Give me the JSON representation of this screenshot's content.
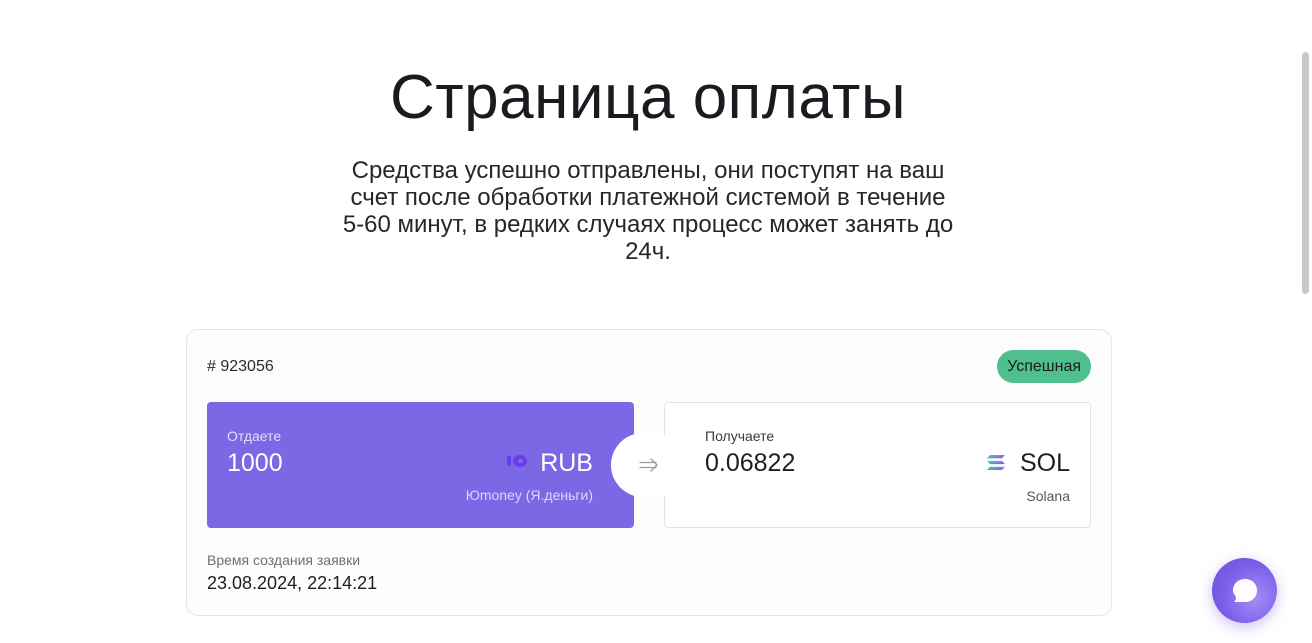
{
  "page": {
    "title": "Страница оплаты",
    "subtitle": "Средства успешно отправлены, они поступят на ваш счет после обработки платежной системой в течение 5-60 минут, в редких случаях процесс может занять до 24ч."
  },
  "order": {
    "number": "# 923056",
    "status": "Успешная",
    "give": {
      "caption": "Отдаете",
      "amount": "1000",
      "currency": "RUB",
      "method": "Юmoney (Я.деньги)",
      "icon": "yoomoney-icon"
    },
    "get": {
      "caption": "Получаете",
      "amount": "0.06822",
      "currency": "SOL",
      "network": "Solana",
      "icon": "solana-icon"
    },
    "created_label": "Время создания заявки",
    "created_value": "23.08.2024, 22:14:21"
  },
  "colors": {
    "accent": "#7b68e4",
    "status_success": "#4fc08d",
    "chat_button": "#7b5fe9"
  },
  "icons": {
    "swap": "arrow-right-icon",
    "chat": "chat-bubble-icon"
  }
}
